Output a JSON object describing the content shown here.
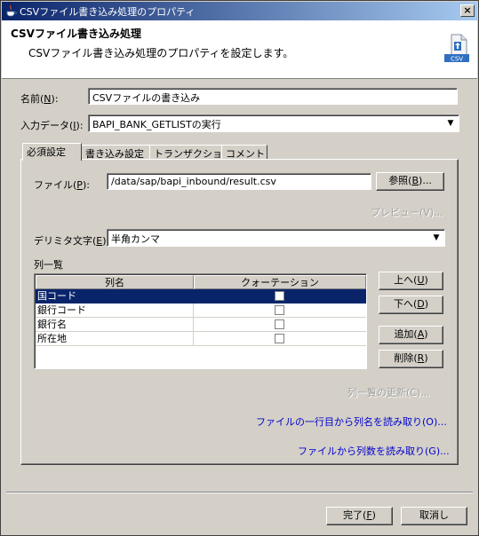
{
  "window": {
    "title": "CSVファイル書き込み処理のプロパティ",
    "close": "×"
  },
  "header": {
    "title": "CSVファイル書き込み処理",
    "description": "CSVファイル書き込み処理のプロパティを設定します。",
    "icon_label": "CSV"
  },
  "form": {
    "name_label": "名前(",
    "name_key": "N",
    "name_value": "CSVファイルの書き込み",
    "input_label": "入力データ(",
    "input_key": "I",
    "input_value": "BAPI_BANK_GETLISTの実行"
  },
  "tabs": [
    {
      "label": "必須設定"
    },
    {
      "label": "書き込み設定"
    },
    {
      "label": "トランザクション"
    },
    {
      "label": "コメント"
    }
  ],
  "required": {
    "file_label": "ファイル(",
    "file_key": "P",
    "file_value": "/data/sap/bapi_inbound/result.csv",
    "browse_label": "参照(",
    "browse_key": "B",
    "browse_suffix": ")...",
    "preview_label": "プレビュー(V)...",
    "delimiter_label": "デリミタ文字(",
    "delimiter_key": "E",
    "delimiter_value": "半角カンマ",
    "list_label": "列一覧",
    "columns": {
      "name": "列名",
      "quote": "クォーテーション"
    },
    "rows": [
      {
        "name": "国コード",
        "selected": true
      },
      {
        "name": "銀行コード",
        "selected": false
      },
      {
        "name": "銀行名",
        "selected": false
      },
      {
        "name": "所在地",
        "selected": false
      }
    ],
    "up_label": "上へ(",
    "up_key": "U",
    "down_label": "下へ(",
    "down_key": "D",
    "add_label": "追加(",
    "add_key": "A",
    "delete_label": "削除(",
    "delete_key": "R",
    "refresh_label": "列一覧の更新(C)...",
    "link1": "ファイルの一行目から列名を読み取り(O)...",
    "link2": "ファイルから列数を読み取り(G)..."
  },
  "footer": {
    "ok_label": "完了(",
    "ok_key": "F",
    "cancel_label": "取消し"
  },
  "colors": {
    "title_gradient_start": "#0a246a",
    "title_gradient_end": "#a6caf0",
    "selection": "#0a246a",
    "link": "#0000cc",
    "face": "#d4d0c8"
  }
}
